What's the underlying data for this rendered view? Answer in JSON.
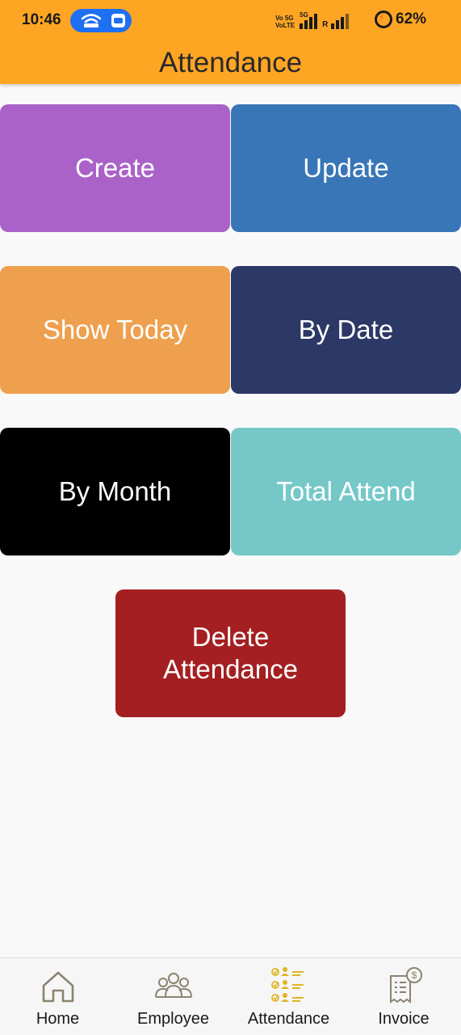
{
  "status_bar": {
    "time": "10:46",
    "volte_label_1": "Vo 5G",
    "volte_label_2": "VoLTE",
    "net_label": "5G",
    "roaming_label": "R",
    "battery": "62%"
  },
  "header": {
    "title": "Attendance"
  },
  "tiles": {
    "create": "Create",
    "update": "Update",
    "show_today": "Show Today",
    "by_date": "By Date",
    "by_month": "By Month",
    "total_attend": "Total Attend",
    "delete_line1": "Delete",
    "delete_line2": "Attendance"
  },
  "bottom_nav": {
    "items": [
      {
        "label": "Home",
        "icon": "home-icon"
      },
      {
        "label": "Employee",
        "icon": "employees-icon"
      },
      {
        "label": "Attendance",
        "icon": "attendance-checklist-icon"
      },
      {
        "label": "Invoice",
        "icon": "invoice-icon"
      }
    ]
  },
  "colors": {
    "header": "#ffa524",
    "create": "#aa62c8",
    "update": "#3876b7",
    "show_today": "#eea04e",
    "by_date": "#2c3866",
    "by_month": "#000000",
    "total_attend": "#76c8c8",
    "delete": "#a41f21"
  }
}
